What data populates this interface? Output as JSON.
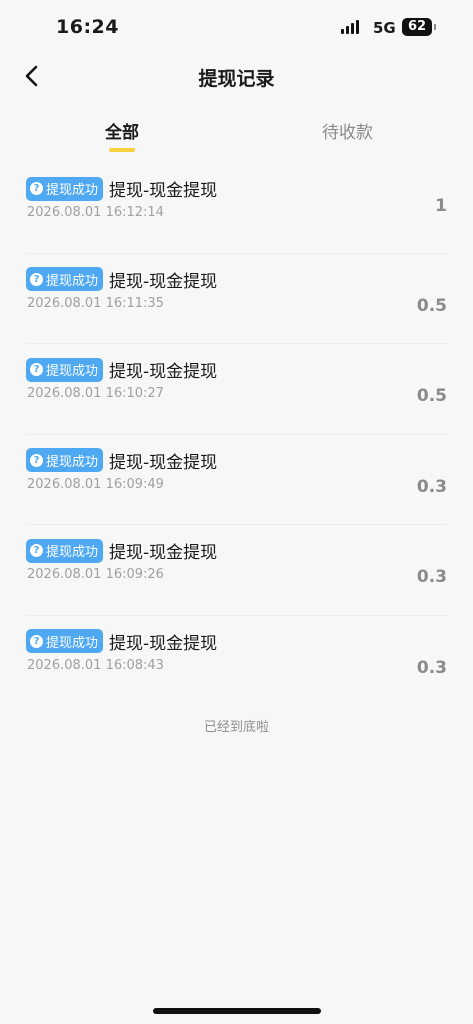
{
  "status_bar": {
    "time": "16:24",
    "network": "5G",
    "battery": "62"
  },
  "header": {
    "title": "提现记录",
    "back_icon": "chevron-left-icon"
  },
  "tabs": [
    {
      "label": "全部",
      "active": true
    },
    {
      "label": "待收款",
      "active": false
    }
  ],
  "records": [
    {
      "status": "提现成功",
      "title": "提现-现金提现",
      "time": "2026.08.01 16:12:14",
      "amount": "1"
    },
    {
      "status": "提现成功",
      "title": "提现-现金提现",
      "time": "2026.08.01 16:11:35",
      "amount": "0.5"
    },
    {
      "status": "提现成功",
      "title": "提现-现金提现",
      "time": "2026.08.01 16:10:27",
      "amount": "0.5"
    },
    {
      "status": "提现成功",
      "title": "提现-现金提现",
      "time": "2026.08.01 16:09:49",
      "amount": "0.3"
    },
    {
      "status": "提现成功",
      "title": "提现-现金提现",
      "time": "2026.08.01 16:09:26",
      "amount": "0.3"
    },
    {
      "status": "提现成功",
      "title": "提现-现金提现",
      "time": "2026.08.01 16:08:43",
      "amount": "0.3"
    }
  ],
  "list_end_text": "已经到底啦",
  "colors": {
    "accent": "#f7d23e",
    "status_tag": "#4ea8f2",
    "amount": "#8a8a8a"
  }
}
